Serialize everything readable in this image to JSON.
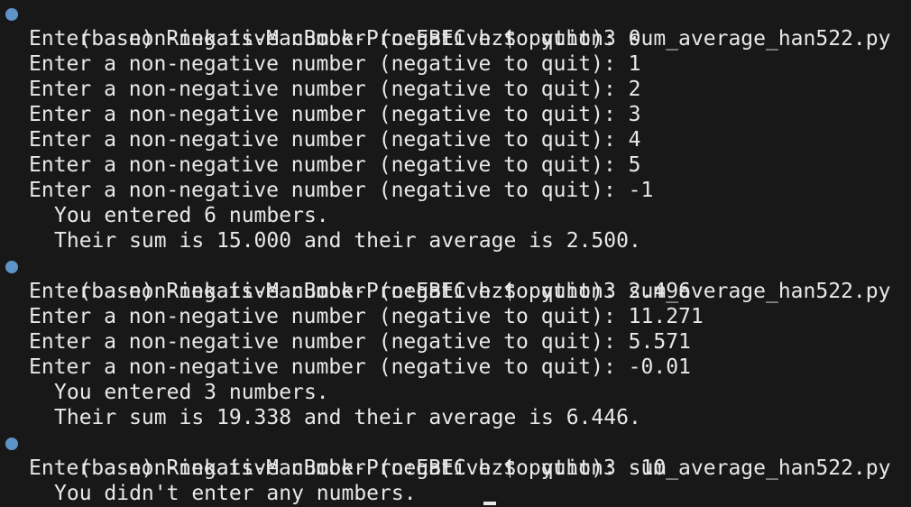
{
  "terminal": {
    "sessions": [
      {
        "command": "(base) Rinkais-MacBook-Pro:EBEC hz$ python3 sum_average_han522.py",
        "inputs": [
          "Enter a non-negative number (negative to quit): 0",
          "Enter a non-negative number (negative to quit): 1",
          "Enter a non-negative number (negative to quit): 2",
          "Enter a non-negative number (negative to quit): 3",
          "Enter a non-negative number (negative to quit): 4",
          "Enter a non-negative number (negative to quit): 5",
          "Enter a non-negative number (negative to quit): -1"
        ],
        "results": [
          "You entered 6 numbers.",
          "Their sum is 15.000 and their average is 2.500."
        ]
      },
      {
        "command": "(base) Rinkais-MacBook-Pro:EBEC hz$ python3 sum_average_han522.py",
        "inputs": [
          "Enter a non-negative number (negative to quit): 2.496",
          "Enter a non-negative number (negative to quit): 11.271",
          "Enter a non-negative number (negative to quit): 5.571",
          "Enter a non-negative number (negative to quit): -0.01"
        ],
        "results": [
          "You entered 3 numbers.",
          "Their sum is 19.338 and their average is 6.446."
        ]
      },
      {
        "command": "(base) Rinkais-MacBook-Pro:EBEC hz$ python3 sum_average_han522.py",
        "inputs": [
          "Enter a non-negative number (negative to quit): -10"
        ],
        "results": [
          "You didn't enter any numbers."
        ]
      }
    ]
  },
  "colors": {
    "background": "#181818",
    "text": "#e8e8e8",
    "prompt_dot": "#5d93c8"
  }
}
